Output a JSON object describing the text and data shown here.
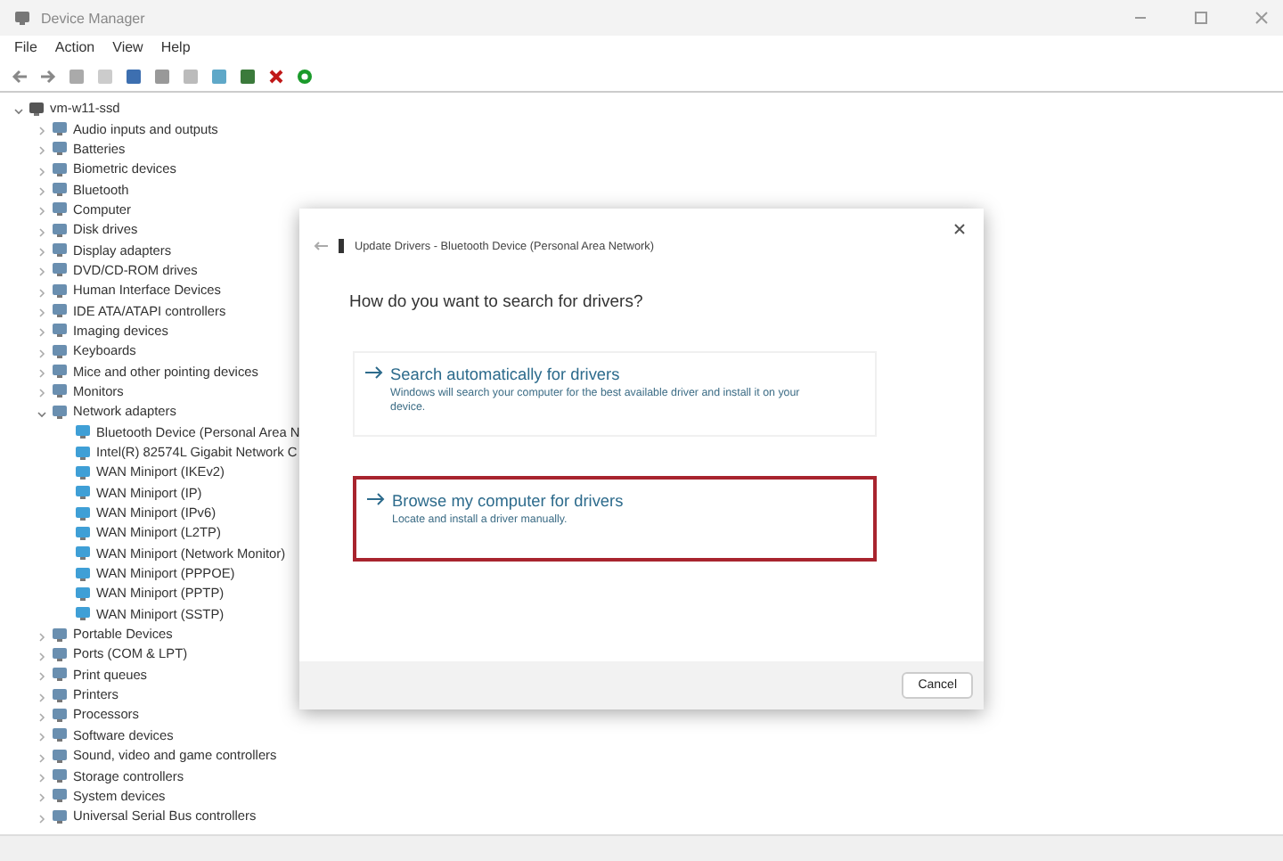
{
  "window": {
    "title": "Device Manager"
  },
  "menu": [
    "File",
    "Action",
    "View",
    "Help"
  ],
  "tree": {
    "label": "vm-w11-ssd",
    "expanded": true,
    "children": [
      {
        "label": "Audio inputs and outputs",
        "expanded": false
      },
      {
        "label": "Batteries",
        "expanded": false
      },
      {
        "label": "Biometric devices",
        "expanded": false
      },
      {
        "label": "Bluetooth",
        "expanded": false
      },
      {
        "label": "Computer",
        "expanded": false
      },
      {
        "label": "Disk drives",
        "expanded": false
      },
      {
        "label": "Display adapters",
        "expanded": false
      },
      {
        "label": "DVD/CD-ROM drives",
        "expanded": false
      },
      {
        "label": "Human Interface Devices",
        "expanded": false
      },
      {
        "label": "IDE ATA/ATAPI controllers",
        "expanded": false
      },
      {
        "label": "Imaging devices",
        "expanded": false
      },
      {
        "label": "Keyboards",
        "expanded": false
      },
      {
        "label": "Mice and other pointing devices",
        "expanded": false
      },
      {
        "label": "Monitors",
        "expanded": false
      },
      {
        "label": "Network adapters",
        "expanded": true,
        "children": [
          {
            "label": "Bluetooth Device (Personal Area N"
          },
          {
            "label": "Intel(R) 82574L Gigabit Network C"
          },
          {
            "label": "WAN Miniport (IKEv2)"
          },
          {
            "label": "WAN Miniport (IP)"
          },
          {
            "label": "WAN Miniport (IPv6)"
          },
          {
            "label": "WAN Miniport (L2TP)"
          },
          {
            "label": "WAN Miniport (Network Monitor)"
          },
          {
            "label": "WAN Miniport (PPPOE)"
          },
          {
            "label": "WAN Miniport (PPTP)"
          },
          {
            "label": "WAN Miniport (SSTP)"
          }
        ]
      },
      {
        "label": "Portable Devices",
        "expanded": false
      },
      {
        "label": "Ports (COM & LPT)",
        "expanded": false
      },
      {
        "label": "Print queues",
        "expanded": false
      },
      {
        "label": "Printers",
        "expanded": false
      },
      {
        "label": "Processors",
        "expanded": false
      },
      {
        "label": "Software devices",
        "expanded": false
      },
      {
        "label": "Sound, video and game controllers",
        "expanded": false
      },
      {
        "label": "Storage controllers",
        "expanded": false
      },
      {
        "label": "System devices",
        "expanded": false
      },
      {
        "label": "Universal Serial Bus controllers",
        "expanded": false
      }
    ]
  },
  "dialog": {
    "title": "Update Drivers - Bluetooth Device (Personal Area Network)",
    "question": "How do you want to search for drivers?",
    "options": [
      {
        "title": "Search automatically for drivers",
        "description": "Windows will search your computer for the best available driver and install it on your device.",
        "selected": false
      },
      {
        "title": "Browse my computer for drivers",
        "description": "Locate and install a driver manually.",
        "selected": true
      }
    ],
    "buttons": [
      "Cancel"
    ]
  }
}
